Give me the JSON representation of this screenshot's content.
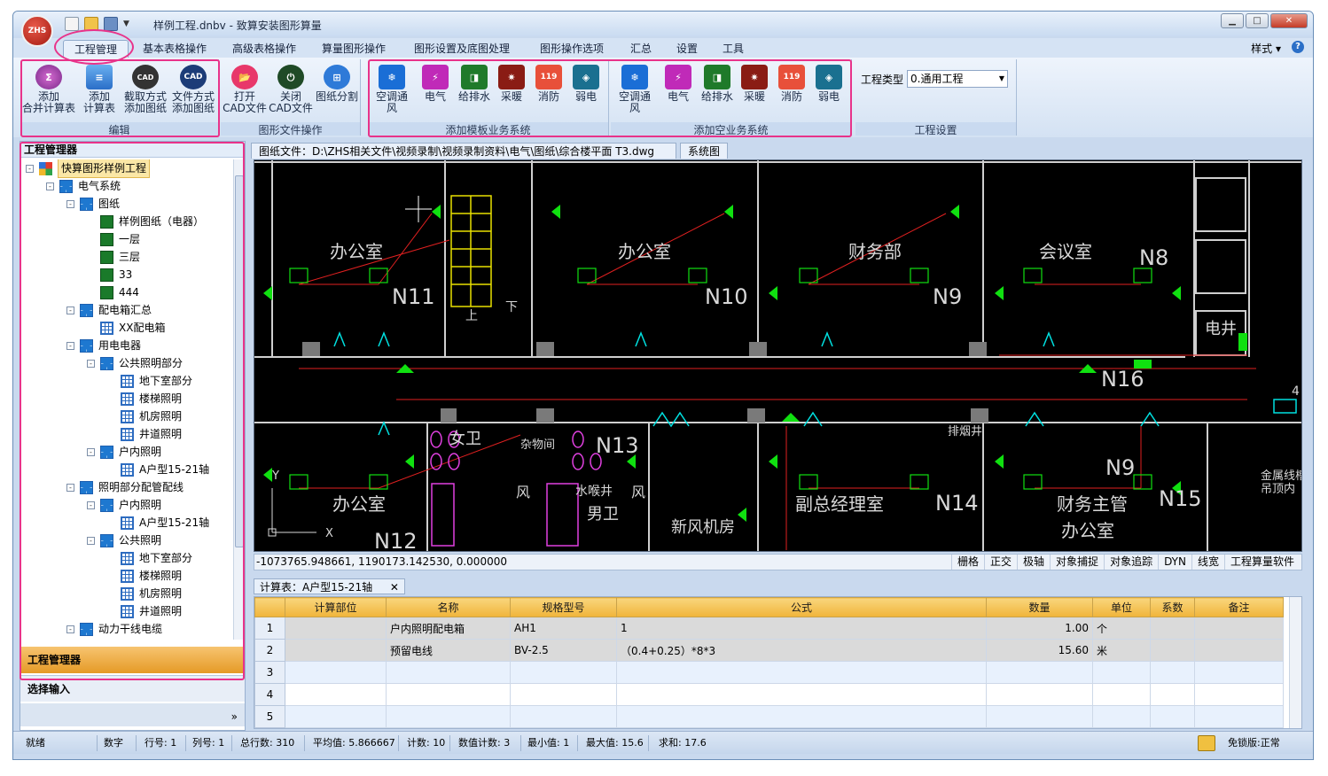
{
  "window": {
    "title": "样例工程.dnbv - 致算安装图形算量",
    "logo_text": "ZHS"
  },
  "tabs": [
    "工程管理",
    "基本表格操作",
    "高级表格操作",
    "算量图形操作",
    "图形设置及底图处理",
    "图形操作选项",
    "汇总",
    "设置",
    "工具"
  ],
  "style_label": "样式",
  "ribbon": {
    "edit": {
      "label": "编辑",
      "buttons": [
        "添加\n合并计算表",
        "添加\n计算表",
        "截取方式\n添加图纸",
        "文件方式\n添加图纸"
      ]
    },
    "cadfile": {
      "label": "图形文件操作",
      "buttons": [
        "打开\nCAD文件",
        "关闭\nCAD文件",
        "图纸分割"
      ]
    },
    "template": {
      "label": "添加模板业务系统",
      "buttons": [
        "空调通风",
        "电气",
        "给排水",
        "采暖",
        "消防",
        "弱电"
      ]
    },
    "empty": {
      "label": "添加空业务系统",
      "buttons": [
        "空调通风",
        "电气",
        "给排水",
        "采暖",
        "消防",
        "弱电"
      ]
    },
    "project": {
      "label": "工程设置",
      "type_label": "工程类型",
      "type_value": "0.通用工程"
    }
  },
  "left_pane": {
    "title": "工程管理器",
    "tree": [
      {
        "label": "快算图形样例工程",
        "level": 0,
        "icon": "colorful",
        "exp": "-"
      },
      {
        "label": "电气系统",
        "level": 1,
        "icon": "win4",
        "exp": "-"
      },
      {
        "label": "图纸",
        "level": 2,
        "icon": "win4",
        "exp": "-"
      },
      {
        "label": "样例图纸（电器）",
        "level": 3,
        "icon": "green"
      },
      {
        "label": "一层",
        "level": 3,
        "icon": "green"
      },
      {
        "label": "三层",
        "level": 3,
        "icon": "green"
      },
      {
        "label": "33",
        "level": 3,
        "icon": "green"
      },
      {
        "label": "444",
        "level": 3,
        "icon": "green"
      },
      {
        "label": "配电箱汇总",
        "level": 2,
        "icon": "win4",
        "exp": "-"
      },
      {
        "label": "XX配电箱",
        "level": 3,
        "icon": "grid"
      },
      {
        "label": "用电电器",
        "level": 2,
        "icon": "win4",
        "exp": "-"
      },
      {
        "label": "公共照明部分",
        "level": 3,
        "icon": "win4",
        "exp": "-"
      },
      {
        "label": "地下室部分",
        "level": 4,
        "icon": "grid"
      },
      {
        "label": "楼梯照明",
        "level": 4,
        "icon": "grid"
      },
      {
        "label": "机房照明",
        "level": 4,
        "icon": "grid"
      },
      {
        "label": "井道照明",
        "level": 4,
        "icon": "grid"
      },
      {
        "label": "户内照明",
        "level": 3,
        "icon": "win4",
        "exp": "-"
      },
      {
        "label": "A户型15-21轴",
        "level": 4,
        "icon": "grid"
      },
      {
        "label": "照明部分配管配线",
        "level": 2,
        "icon": "win4",
        "exp": "-"
      },
      {
        "label": "户内照明",
        "level": 3,
        "icon": "win4",
        "exp": "-"
      },
      {
        "label": "A户型15-21轴",
        "level": 4,
        "icon": "grid"
      },
      {
        "label": "公共照明",
        "level": 3,
        "icon": "win4",
        "exp": "-"
      },
      {
        "label": "地下室部分",
        "level": 4,
        "icon": "grid"
      },
      {
        "label": "楼梯照明",
        "level": 4,
        "icon": "grid"
      },
      {
        "label": "机房照明",
        "level": 4,
        "icon": "grid"
      },
      {
        "label": "井道照明",
        "level": 4,
        "icon": "grid"
      },
      {
        "label": "动力干线电缆",
        "level": 2,
        "icon": "win4",
        "exp": "-"
      }
    ],
    "bottom_tabs": [
      "工程管理器",
      "选择输入"
    ],
    "expand_glyph": "»"
  },
  "doc_tabs": [
    "图纸文件：D:\\ZHS相关文件\\视频录制\\视频录制资料\\电气\\图纸\\综合楼平面 T3.dwg",
    "系统图"
  ],
  "cad": {
    "rooms": [
      "办公室",
      "办公室",
      "财务部",
      "会议室",
      "电井",
      "办公室",
      "女卫",
      "男卫",
      "新风机房",
      "副总经理室",
      "财务主管",
      "办公室",
      "杂物间",
      "水喉井",
      "风",
      "风",
      "排烟井"
    ],
    "nodes": [
      "N8",
      "N11",
      "N10",
      "N9",
      "N16",
      "N13",
      "N9",
      "N14",
      "N15",
      "N12"
    ],
    "stairs": [
      "上",
      "下"
    ],
    "misc": [
      "金属线槽",
      "吊顶内",
      "4",
      "X",
      "Y"
    ]
  },
  "command": {
    "coord": "-1073765.948661,  1190173.142530,  0.000000",
    "modes": [
      "栅格",
      "正交",
      "极轴",
      "对象捕捉",
      "对象追踪",
      "DYN",
      "线宽",
      "工程算量软件"
    ]
  },
  "calc": {
    "tab": "计算表：A户型15-21轴",
    "columns": [
      "计算部位",
      "名称",
      "规格型号",
      "公式",
      "数量",
      "单位",
      "系数",
      "备注"
    ],
    "rows": [
      {
        "n": "1",
        "part": "",
        "name": "户内照明配电箱",
        "spec": "AH1",
        "formula": "1",
        "qty": "1.00",
        "unit": "个",
        "coef": "",
        "note": ""
      },
      {
        "n": "2",
        "part": "",
        "name": "预留电线",
        "spec": "BV-2.5",
        "formula": "（0.4+0.25）*8*3",
        "qty": "15.60",
        "unit": "米",
        "coef": "",
        "note": ""
      },
      {
        "n": "3",
        "part": "",
        "name": "",
        "spec": "",
        "formula": "",
        "qty": "",
        "unit": "",
        "coef": "",
        "note": ""
      },
      {
        "n": "4",
        "part": "",
        "name": "",
        "spec": "",
        "formula": "",
        "qty": "",
        "unit": "",
        "coef": "",
        "note": ""
      },
      {
        "n": "5",
        "part": "",
        "name": "",
        "spec": "",
        "formula": "",
        "qty": "",
        "unit": "",
        "coef": "",
        "note": ""
      }
    ]
  },
  "status": {
    "ready": "就绪",
    "num": "数字",
    "row": "行号: 1",
    "col": "列号: 1",
    "total": "总行数: 310",
    "avg": "平均值: 5.866667",
    "count": "计数: 10",
    "numcount": "数值计数: 3",
    "min": "最小值: 1",
    "max": "最大值: 15.6",
    "sum": "求和: 17.6",
    "license": "免锁版:正常"
  },
  "colors": {
    "accent": "#e8338a",
    "ribbon": "#d4e2f3",
    "cad_bg": "#000000"
  }
}
